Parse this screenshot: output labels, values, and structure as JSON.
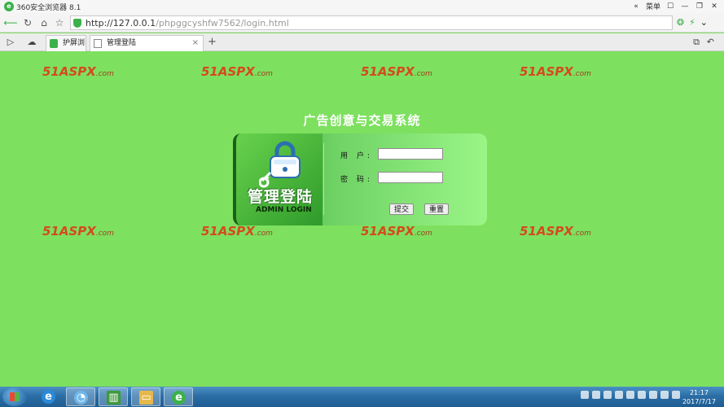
{
  "browser": {
    "title": "360安全浏览器 8.1",
    "title_right": [
      "«",
      "菜单",
      "☐",
      "—",
      "❐",
      "✕"
    ],
    "url_host": "http://127.0.0.1",
    "url_path": "/phpggcyshfw7562/login.html",
    "addr_right_icons": [
      "❂",
      "⚡",
      "⌄"
    ],
    "tabs": [
      {
        "label": "护屏浏览",
        "icon": "green-screen-icon"
      },
      {
        "label": "管理登陆",
        "icon": "page-icon",
        "close": "×"
      }
    ],
    "new_tab": "+",
    "tab_right_icons": [
      "⧉",
      "↶"
    ]
  },
  "page": {
    "system_title": "广告创意与交易系统",
    "watermark": {
      "num": "51",
      "brand": "ASPX",
      "dom": ".com"
    },
    "login": {
      "header_cn": "管理登陆",
      "header_en": "ADMIN LOGIN",
      "user_label": "用 户:",
      "pass_label": "密 码:",
      "user_value": "",
      "pass_value": "",
      "submit_label": "提交",
      "reset_label": "重置"
    }
  },
  "taskbar": {
    "time": "21:17",
    "date": "2017/7/17"
  },
  "colors": {
    "page_bg": "#7de05f",
    "watermark": "#d44a1f",
    "brand_green": "#3cb14a"
  }
}
